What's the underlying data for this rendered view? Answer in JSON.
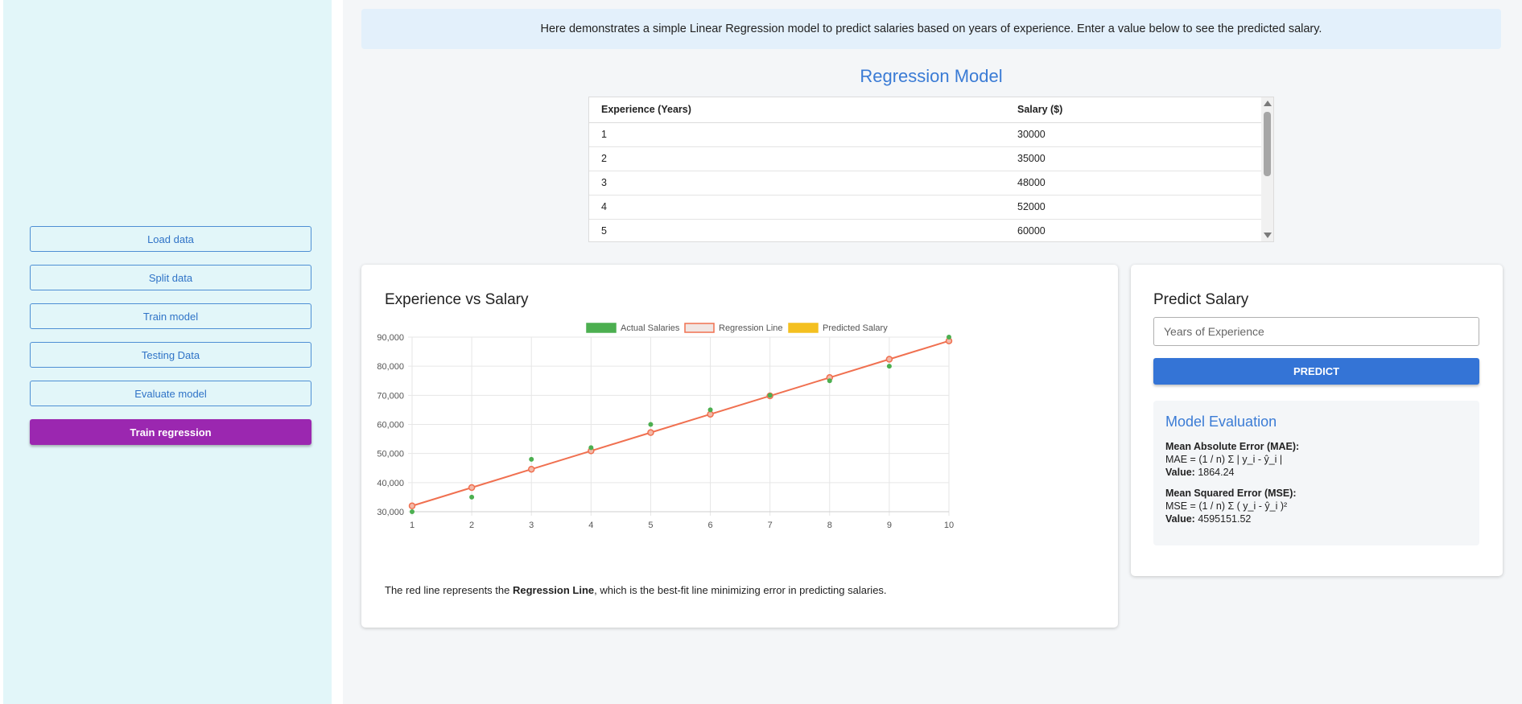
{
  "sidebar": {
    "buttons": [
      {
        "label": "Load data"
      },
      {
        "label": "Split data"
      },
      {
        "label": "Train model"
      },
      {
        "label": "Testing Data"
      },
      {
        "label": "Evaluate model"
      },
      {
        "label": "Train regression"
      }
    ]
  },
  "banner": {
    "text": "Here demonstrates a simple Linear Regression model to predict salaries based on years of experience. Enter a value below to see the predicted salary."
  },
  "model_section": {
    "title": "Regression Model",
    "table": {
      "columns": [
        "Experience (Years)",
        "Salary ($)"
      ],
      "rows": [
        [
          "1",
          "30000"
        ],
        [
          "2",
          "35000"
        ],
        [
          "3",
          "48000"
        ],
        [
          "4",
          "52000"
        ],
        [
          "5",
          "60000"
        ]
      ]
    }
  },
  "chart_card": {
    "title": "Experience vs Salary",
    "caption_before": "The red line represents the ",
    "caption_bold": "Regression Line",
    "caption_after": ", which is the best-fit line minimizing error in predicting salaries."
  },
  "chart_data": {
    "type": "scatter",
    "title": "",
    "xlabel": "",
    "ylabel": "",
    "xlim": [
      1,
      10
    ],
    "ylim": [
      30000,
      90000
    ],
    "x_ticks": [
      "1",
      "2",
      "3",
      "4",
      "5",
      "6",
      "7",
      "8",
      "9",
      "10"
    ],
    "y_ticks": [
      "30,000",
      "40,000",
      "50,000",
      "60,000",
      "70,000",
      "80,000",
      "90,000"
    ],
    "grid": true,
    "legend_position": "top",
    "series": [
      {
        "name": "Actual Salaries",
        "type": "scatter",
        "color": "#4caf50",
        "x": [
          1,
          2,
          3,
          4,
          5,
          6,
          7,
          8,
          9,
          10
        ],
        "y": [
          30000,
          35000,
          48000,
          52000,
          60000,
          65000,
          70000,
          75000,
          80000,
          90000
        ]
      },
      {
        "name": "Regression Line",
        "type": "line",
        "color": "#f07050",
        "x": [
          1,
          2,
          3,
          4,
          5,
          6,
          7,
          8,
          9,
          10
        ],
        "y": [
          32000,
          38300,
          44600,
          50900,
          57200,
          63500,
          69800,
          76100,
          82400,
          88700
        ]
      },
      {
        "name": "Predicted Salary",
        "type": "scatter",
        "color": "#f4c020",
        "x": [],
        "y": []
      }
    ]
  },
  "predict": {
    "title": "Predict Salary",
    "input_placeholder": "Years of Experience",
    "button_label": "PREDICT"
  },
  "evaluation": {
    "title": "Model Evaluation",
    "mae_label": "Mean Absolute Error (MAE):",
    "mae_formula": "MAE = (1 / n) Σ | y_i - ŷ_i |",
    "value_label": "Value:",
    "mae_value": "1864.24",
    "mse_label": "Mean Squared Error (MSE):",
    "mse_formula": "MSE = (1 / n) Σ ( y_i - ŷ_i )²",
    "mse_value": "4595151.52"
  },
  "colors": {
    "accent": "#3a7bd5",
    "active_button": "#9b27b0",
    "predict_button": "#3474d6"
  }
}
